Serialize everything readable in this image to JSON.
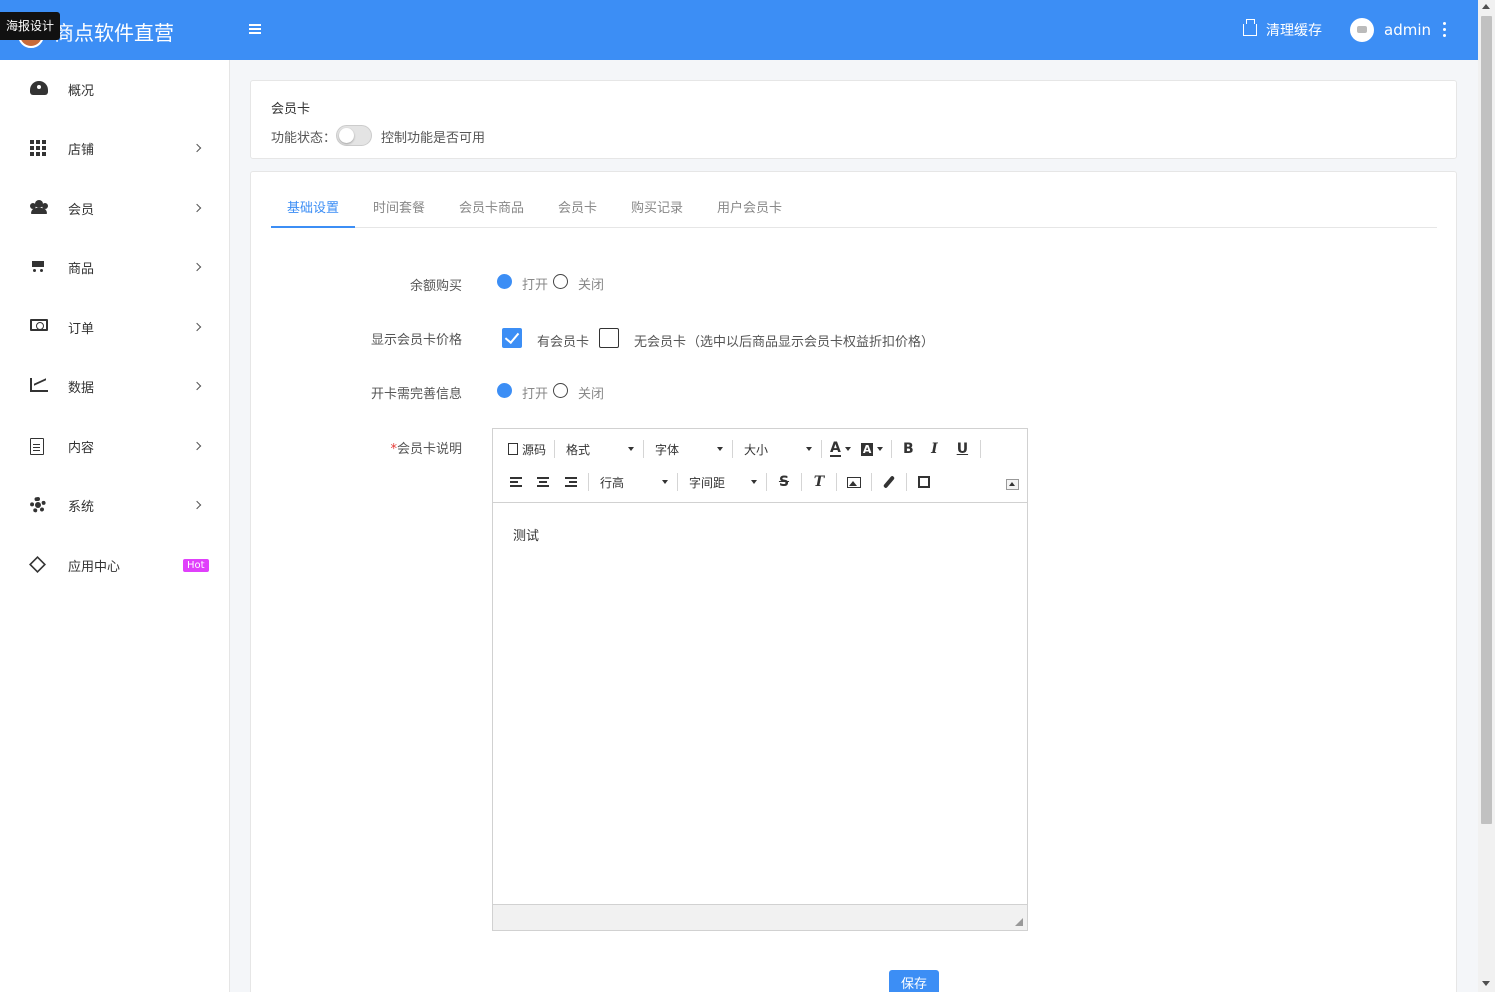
{
  "header": {
    "brand_text": "商点软件直营",
    "tooltip": "海报设计",
    "clear_cache": "清理缓存",
    "username": "admin",
    "color": "#3c8ef5"
  },
  "sidebar": {
    "items": [
      {
        "label": "概况",
        "icon": "dashboard-icon"
      },
      {
        "label": "店铺",
        "icon": "grid-icon"
      },
      {
        "label": "会员",
        "icon": "users-icon"
      },
      {
        "label": "商品",
        "icon": "cart-icon"
      },
      {
        "label": "订单",
        "icon": "money-icon"
      },
      {
        "label": "数据",
        "icon": "line-chart-icon"
      },
      {
        "label": "内容",
        "icon": "file-icon"
      },
      {
        "label": "系统",
        "icon": "gear-icon"
      },
      {
        "label": "应用中心",
        "icon": "cube-icon",
        "badge": "Hot"
      }
    ]
  },
  "feature_card": {
    "title": "会员卡",
    "status_label": "功能状态：",
    "switch_hint": "控制功能是否可用",
    "enabled": false
  },
  "tabs": [
    {
      "label": "基础设置",
      "active": true
    },
    {
      "label": "时间套餐",
      "active": false
    },
    {
      "label": "会员卡商品",
      "active": false
    },
    {
      "label": "会员卡",
      "active": false
    },
    {
      "label": "购买记录",
      "active": false
    },
    {
      "label": "用户会员卡",
      "active": false
    }
  ],
  "form": {
    "balance_purchase": {
      "label": "余额购买",
      "on": "打开",
      "off": "关闭",
      "value": "打开"
    },
    "show_price": {
      "label": "显示会员卡价格",
      "opt1": "有会员卡",
      "opt2": "无会员卡",
      "hint": "（选中以后商品显示会员卡权益折扣价格）",
      "checked": [
        "有会员卡"
      ]
    },
    "complete_info": {
      "label": "开卡需完善信息",
      "on": "打开",
      "off": "关闭",
      "value": "打开"
    },
    "description": {
      "required_mark": "*",
      "label": "会员卡说明",
      "content": "测试"
    }
  },
  "editor": {
    "source": "源码",
    "format": "格式",
    "font": "字体",
    "size": "大小",
    "line_height": "行高",
    "letter_spacing": "字间距",
    "bold": "B",
    "italic": "I",
    "underline": "U",
    "strike": "S",
    "clear_format": "T",
    "text_color": "A",
    "bg_color": "A"
  },
  "save_button": "保存"
}
